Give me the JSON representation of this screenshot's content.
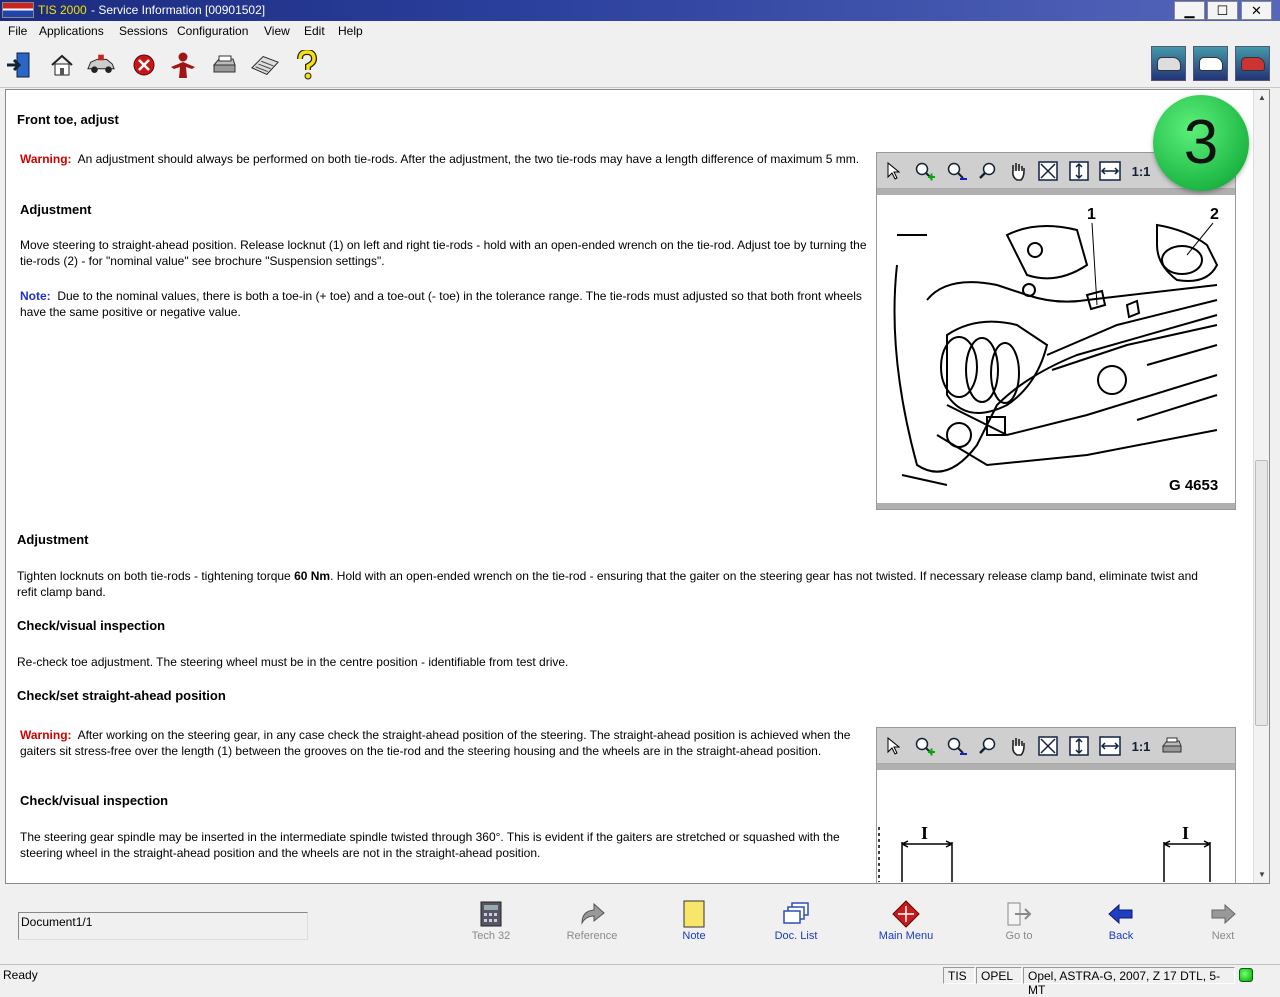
{
  "window": {
    "app_name": "TIS 2000",
    "title_rest": "- Service Information [00901502]",
    "controls": {
      "minimize": "▁",
      "maximize": "☐",
      "close": "✕"
    }
  },
  "menu": [
    "File",
    "Applications",
    "Sessions",
    "Configuration",
    "View",
    "Edit",
    "Help"
  ],
  "toolbar_icons": [
    "exit-icon",
    "home-icon",
    "vehicle-icon",
    "stop-icon",
    "person-icon",
    "print-icon",
    "keyboard-icon",
    "help-icon"
  ],
  "toolbar_right_icons": [
    "vehicle-info-icon",
    "ambulance-icon",
    "vehicle-select-icon"
  ],
  "document": {
    "title": "Front toe, adjust",
    "warning1": {
      "label": "Warning:",
      "text": "An adjustment should always be performed on both tie-rods. After the adjustment, the two tie-rods may have a length difference of maximum 5 mm."
    },
    "adjustment1_heading": "Adjustment",
    "adjustment1_text": "Move steering to straight-ahead position. Release locknut (1) on left and right tie-rods - hold with an open-ended wrench on the tie-rod. Adjust toe by turning the tie-rods (2) - for \"nominal value\" see brochure \"Suspension settings\".",
    "note": {
      "label": "Note:",
      "text": "Due to the nominal values, there is both a toe-in (+ toe) and a toe-out (- toe) in the tolerance range. The tie-rods must adjusted so that both front wheels have the same positive or negative value."
    },
    "adjustment2_heading": "Adjustment",
    "adjustment2_pre": "Tighten locknuts on both tie-rods - tightening torque",
    "adjustment2_torque": "60 Nm",
    "adjustment2_post": ". Hold with an open-ended wrench on the tie-rod - ensuring that the gaiter on the steering gear has not twisted. If necessary release clamp band, eliminate twist and refit clamp band.",
    "check1_heading": "Check/visual inspection",
    "check1_text": "Re-check toe adjustment. The steering wheel must be in the centre position - identifiable from test drive.",
    "straight_heading": "Check/set straight-ahead position",
    "warning2": {
      "label": "Warning:",
      "text": "After working on the steering gear, in any case check the straight-ahead position of the steering. The straight-ahead position is achieved when the gaiters sit stress-free over the length (1) between the grooves on the tie-rod and the steering housing and the wheels are in the straight-ahead position."
    },
    "check2_heading": "Check/visual inspection",
    "check2_text": "The steering gear spindle may be inserted in the intermediate spindle twisted through 360°. This is evident if the gaiters are stretched or squashed with the steering wheel in the straight-ahead position and the wheels are not in the straight-ahead position."
  },
  "viewer1": {
    "tools": [
      "select-icon",
      "zoom-in-icon",
      "zoom-out-icon",
      "zoom-icon",
      "pan-icon",
      "fit-icon",
      "fit-height-icon",
      "fit-width-icon"
    ],
    "scale_label": "1:1",
    "figure_id": "G 4653",
    "callout_1": "1",
    "callout_2": "2"
  },
  "viewer2": {
    "tools": [
      "select-icon",
      "zoom-in-icon",
      "zoom-out-icon",
      "zoom-icon",
      "pan-icon",
      "fit-icon",
      "fit-height-icon",
      "fit-width-icon",
      "print-icon"
    ],
    "scale_label": "1:1",
    "dim_label_1": "I",
    "dim_label_2": "I"
  },
  "step_badge": "3",
  "nav": {
    "document_field": "Document1/1",
    "buttons": [
      {
        "label": "Tech 32",
        "enabled": false
      },
      {
        "label": "Reference",
        "enabled": false
      },
      {
        "label": "Note",
        "enabled": true
      },
      {
        "label": "Doc. List",
        "enabled": true
      },
      {
        "label": "Main Menu",
        "enabled": true
      },
      {
        "label": "Go to",
        "enabled": false
      },
      {
        "label": "Back",
        "enabled": true
      },
      {
        "label": "Next",
        "enabled": false
      }
    ]
  },
  "status": {
    "ready": "Ready",
    "system": "TIS",
    "brand": "OPEL",
    "vehicle": "Opel, ASTRA-G, 2007, Z 17 DTL, 5-MT"
  },
  "colors": {
    "warning": "#d00000",
    "note": "#2030d0",
    "badge": "#1fb845"
  }
}
